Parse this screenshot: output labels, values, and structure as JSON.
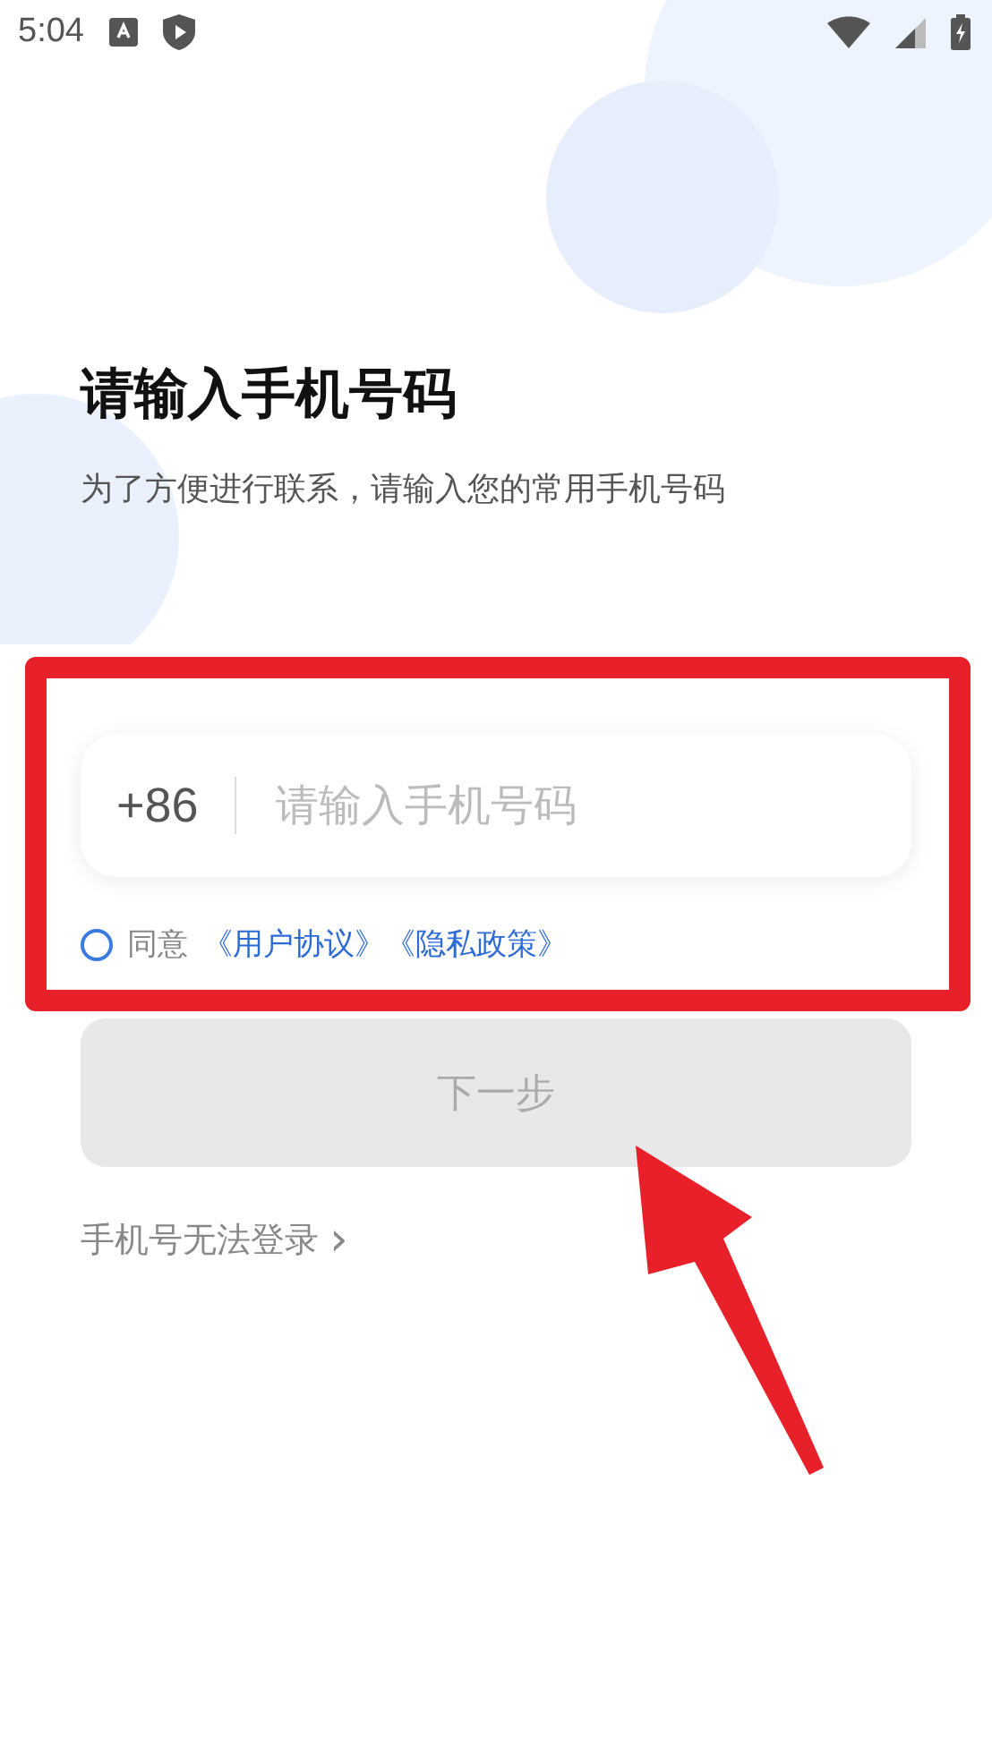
{
  "status_bar": {
    "time": "5:04"
  },
  "title": "请输入手机号码",
  "subtitle": "为了方便进行联系，请输入您的常用手机号码",
  "phone_field": {
    "country_code": "+86",
    "placeholder": "请输入手机号码"
  },
  "agreement": {
    "checked": false,
    "prefix": "同意",
    "links": [
      "《用户协议》",
      "《隐私政策》"
    ]
  },
  "next_button": {
    "label": "下一步",
    "disabled": true
  },
  "help_link": {
    "label": "手机号无法登录",
    "arrow": "›"
  }
}
